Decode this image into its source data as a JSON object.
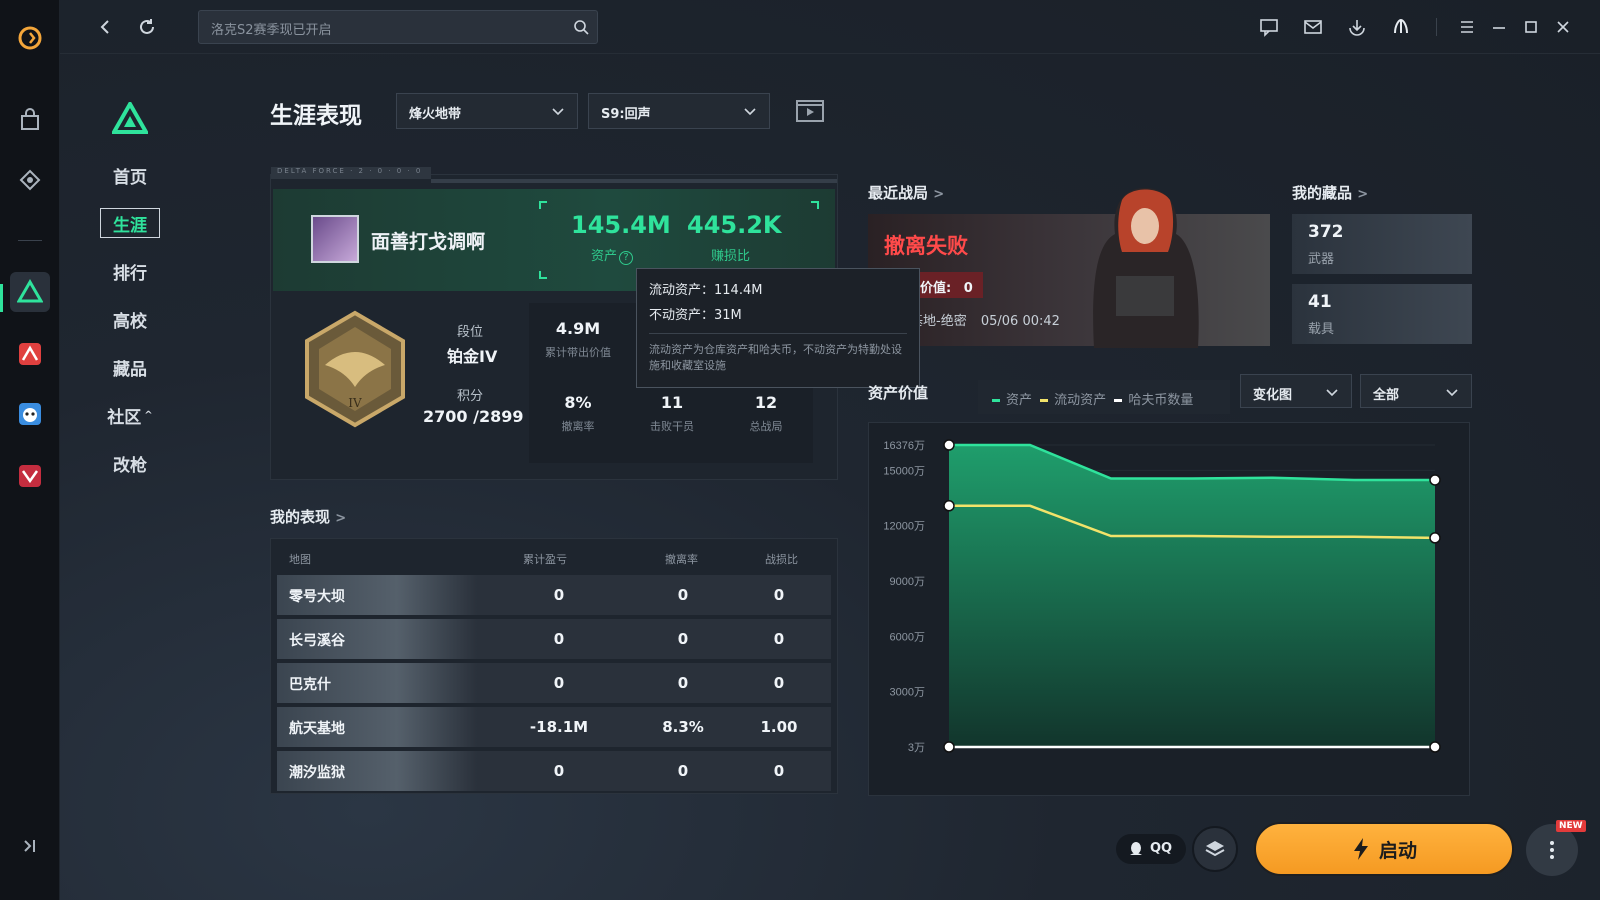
{
  "search": {
    "placeholder": "洛克S2赛季现已开启"
  },
  "nav": {
    "items": [
      {
        "label": "首页",
        "active": false
      },
      {
        "label": "生涯",
        "active": true
      },
      {
        "label": "排行",
        "active": false
      },
      {
        "label": "高校",
        "active": false
      },
      {
        "label": "藏品",
        "active": false
      },
      {
        "label": "社区",
        "active": false
      },
      {
        "label": "改枪",
        "active": false
      }
    ]
  },
  "header": {
    "title": "生涯表现",
    "mode_select": "烽火地带",
    "season_select": "S9:回声"
  },
  "profile": {
    "tab_caption": "DELTA FORCE · 2 · 0 · 0 · 0",
    "player_name": "面善打戈调啊",
    "assets_value": "145.4M",
    "assets_label": "资产",
    "ratio_value": "445.2K",
    "ratio_label": "赚损比",
    "rank_label": "段位",
    "rank_value": "铂金IV",
    "score_label": "积分",
    "score_value": "2700 /2899",
    "stats": [
      {
        "value": "4.9M",
        "label": "累计带出价值"
      },
      {
        "value": "8%",
        "label": "撤离率"
      },
      {
        "value": "11",
        "label": "击败干员"
      },
      {
        "value": "12",
        "label": "总战局"
      }
    ]
  },
  "tooltip": {
    "liquid": "流动资产：114.4M",
    "fixed": "不动资产：31M",
    "note": "流动资产为仓库资产和哈夫币，不动资产为特勤处设施和收藏室设施"
  },
  "performance": {
    "title": "我的表现",
    "headers": [
      "地图",
      "累计盈亏",
      "撤离率",
      "战损比"
    ],
    "rows": [
      {
        "map": "零号大坝",
        "profit": "0",
        "rate": "0",
        "ratio": "0"
      },
      {
        "map": "长弓溪谷",
        "profit": "0",
        "rate": "0",
        "ratio": "0"
      },
      {
        "map": "巴克什",
        "profit": "0",
        "rate": "0",
        "ratio": "0"
      },
      {
        "map": "航天基地",
        "profit": "-18.1M",
        "rate": "8.3%",
        "ratio": "1.00"
      },
      {
        "map": "潮汐监狱",
        "profit": "0",
        "rate": "0",
        "ratio": "0"
      }
    ]
  },
  "recent": {
    "title": "最近战局",
    "result": "撤离失败",
    "value_label": "带出价值:",
    "value": "0",
    "map": "航天基地-绝密",
    "time": "05/06 00:42"
  },
  "collection": {
    "title": "我的藏品",
    "items": [
      {
        "count": "372",
        "label": "武器"
      },
      {
        "count": "41",
        "label": "载具"
      }
    ]
  },
  "asset_chart": {
    "title": "资产价值",
    "legend": [
      "资产",
      "流动资产",
      "哈夫币数量"
    ],
    "view_select": "变化图",
    "range_select": "全部"
  },
  "chart_data": {
    "type": "area",
    "ylabel": "",
    "y_ticks": [
      "16376万",
      "15000万",
      "12000万",
      "9000万",
      "6000万",
      "3000万",
      "3万"
    ],
    "ylim": [
      3,
      16376
    ],
    "x": [
      0,
      1,
      2,
      3,
      4,
      5,
      6
    ],
    "series": [
      {
        "name": "资产",
        "color": "#2fe39c",
        "values": [
          16376,
          16376,
          14560,
          14560,
          14600,
          14480,
          14480
        ]
      },
      {
        "name": "流动资产",
        "color": "#f2e36a",
        "values": [
          13080,
          13080,
          11440,
          11440,
          11400,
          11400,
          11340
        ]
      },
      {
        "name": "哈夫币数量",
        "color": "#ffffff",
        "values": [
          3,
          3,
          3,
          3,
          3,
          3,
          3
        ]
      }
    ]
  },
  "footer": {
    "qq_label": "QQ",
    "launch_label": "启动",
    "new_badge": "NEW"
  },
  "colors": {
    "accent": "#2fe39c",
    "fail": "#ff4a4a",
    "launch": "#f8a93a"
  }
}
